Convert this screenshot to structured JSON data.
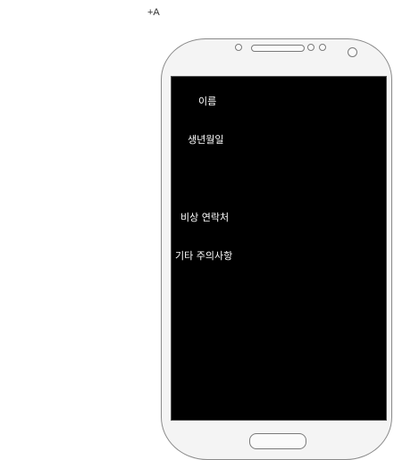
{
  "corner_label": "+A",
  "form": {
    "fields": [
      {
        "label": "이름"
      },
      {
        "label": "생년월일"
      },
      {
        "label": "비상 연락처"
      },
      {
        "label": "기타 주의사항"
      }
    ]
  }
}
